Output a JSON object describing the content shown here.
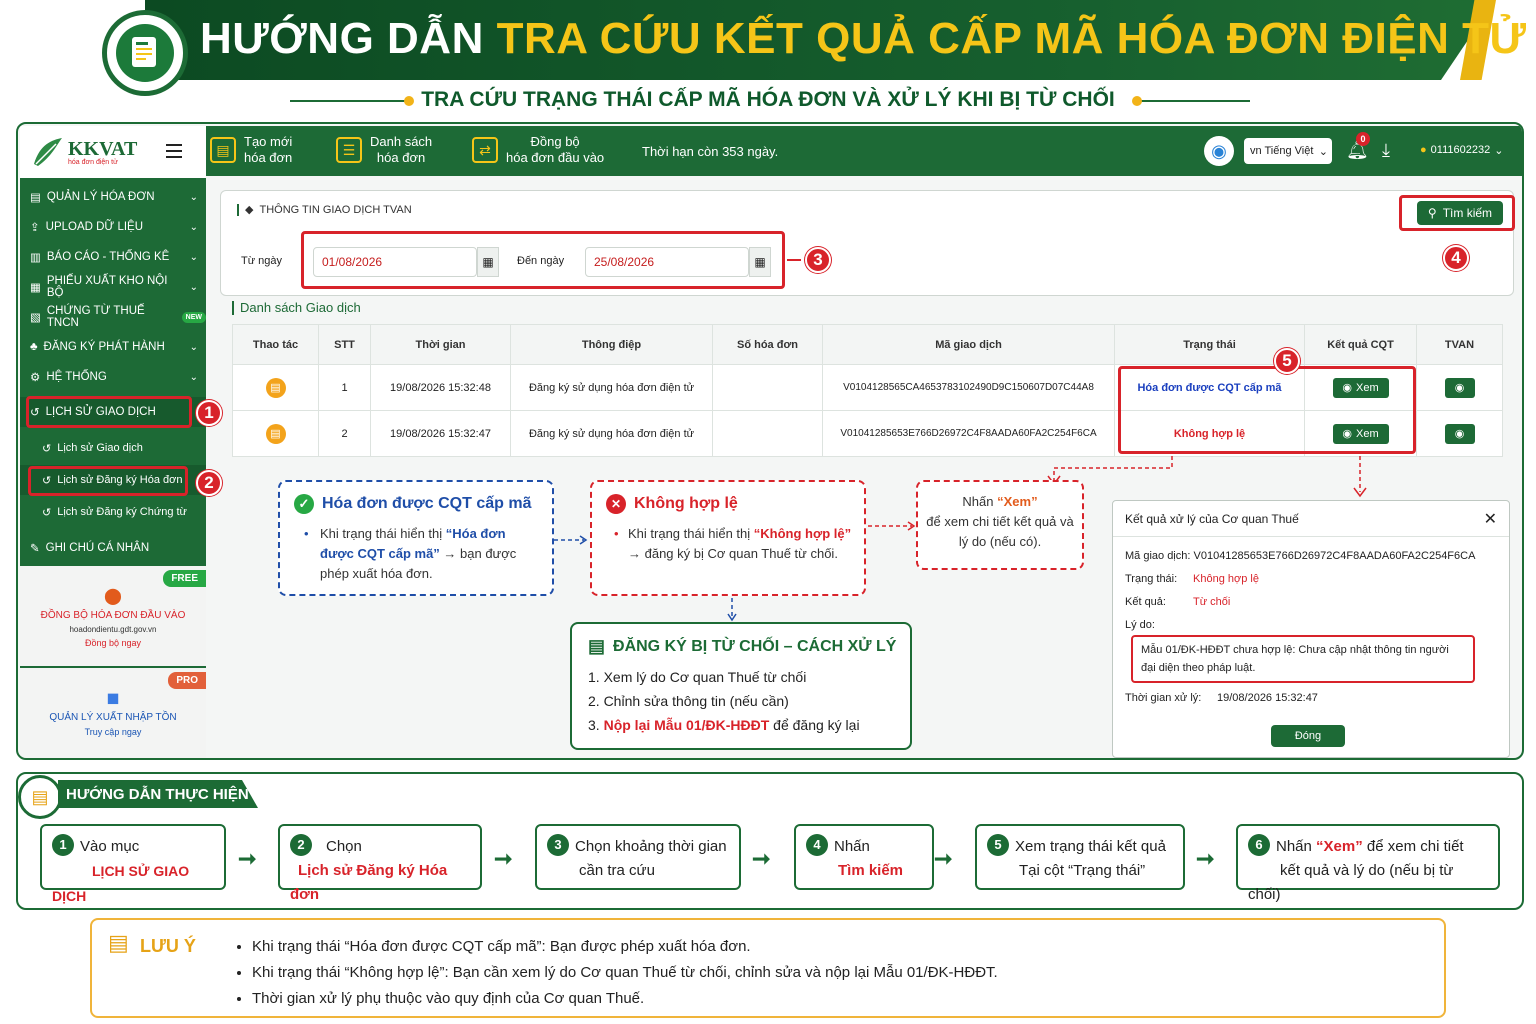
{
  "banner": {
    "title_white": "HƯỚNG DẪN",
    "title_yellow": "TRA CỨU KẾT QUẢ CẤP MÃ HÓA ĐƠN ĐIỆN TỬ",
    "subtitle": "TRA CỨU TRẠNG THÁI CẤP MÃ HÓA ĐƠN VÀ XỬ LÝ KHI BỊ TỪ CHỐI"
  },
  "sidebar": {
    "brand": "KKVAT",
    "brand_sub": "hóa đơn điện tử",
    "menu": [
      {
        "label": "QUẢN LÝ HÓA ĐƠN",
        "icon": "file-icon"
      },
      {
        "label": "UPLOAD DỮ LIỆU",
        "icon": "upload-icon"
      },
      {
        "label": "BÁO CÁO - THỐNG KÊ",
        "icon": "chart-icon"
      },
      {
        "label": "PHIẾU XUẤT KHO NỘI BỘ",
        "icon": "doc-icon"
      },
      {
        "label": "CHỨNG TỪ THUẾ TNCN",
        "icon": "doc-icon",
        "badge": "NEW"
      },
      {
        "label": "ĐĂNG KÝ PHÁT HÀNH",
        "icon": "bell-icon"
      },
      {
        "label": "HỆ THỐNG",
        "icon": "gear-icon"
      },
      {
        "label": "LỊCH SỬ GIAO DỊCH",
        "icon": "history-icon"
      }
    ],
    "submenu": [
      "Lịch sử Giao dịch",
      "Lịch sử Đăng ký Hóa đơn",
      "Lịch sử Đăng ký Chứng từ"
    ],
    "ghi_chu": "GHI CHÚ CÁ NHÂN",
    "promo1": {
      "badge": "FREE",
      "title": "ĐỒNG BỘ HÓA ĐƠN ĐẦU VÀO",
      "url": "hoadondientu.gdt.gov.vn",
      "link": "Đồng bộ ngay"
    },
    "promo2": {
      "badge": "PRO",
      "title": "QUẢN LÝ XUẤT NHẬP TỒN",
      "link": "Truy cập ngay"
    }
  },
  "topbar": {
    "btn1": [
      "Tạo mới",
      "hóa đơn"
    ],
    "btn2": [
      "Danh sách",
      "hóa đơn"
    ],
    "btn3": [
      "Đồng bộ",
      "hóa đơn đầu vào"
    ],
    "deadline": "Thời hạn còn 353 ngày.",
    "language": "vn Tiếng Việt",
    "notif_count": "0",
    "user": "0111602232"
  },
  "filter": {
    "section_title": "THÔNG TIN GIAO DỊCH TVAN",
    "from_label": "Từ ngày",
    "from_value": "01/08/2026",
    "to_label": "Đến ngày",
    "to_value": "25/08/2026",
    "search_btn": "Tìm kiếm"
  },
  "list": {
    "title": "Danh sách Giao dịch",
    "headers": [
      "Thao tác",
      "STT",
      "Thời gian",
      "Thông điệp",
      "Số hóa đơn",
      "Mã giao dịch",
      "Trạng thái",
      "Kết quả CQT",
      "TVAN"
    ],
    "rows": [
      {
        "stt": "1",
        "time": "19/08/2026 15:32:48",
        "msg": "Đăng ký sử dụng hóa đơn điện tử",
        "invoice": "",
        "code": "V0104128565CA4653783102490D9C150607D07C44A8",
        "status": "Hóa đơn được CQT cấp mã",
        "status_color": "#1a3fbf",
        "result": "Xem"
      },
      {
        "stt": "2",
        "time": "19/08/2026 15:32:47",
        "msg": "Đăng ký sử dụng hóa đơn điện tử",
        "invoice": "",
        "code": "V01041285653E766D26972C4F8AADA60FA2C254F6CA",
        "status": "Không hợp lệ",
        "status_color": "#d8232a",
        "result": "Xem"
      }
    ]
  },
  "notes": {
    "ok_title": "Hóa đơn được CQT cấp mã",
    "ok_text_1": "Khi trạng thái hiển thị ",
    "ok_text_bold": "“Hóa đơn được CQT cấp mã”",
    "ok_text_2": " → bạn được phép xuất hóa đơn.",
    "bad_title": "Không hợp lệ",
    "bad_text_1": "Khi trạng thái hiển thị ",
    "bad_text_bold": "“Không hợp lệ”",
    "bad_text_2": " → đăng ký bị Cơ quan Thuế từ chối.",
    "view_1": "Nhấn ",
    "view_bold": "“Xem”",
    "view_2": "để xem chi tiết kết quả và lý do (nếu có)."
  },
  "reject": {
    "title": "ĐĂNG KÝ BỊ TỪ CHỐI – CÁCH XỬ LÝ",
    "items": [
      "1. Xem lý do Cơ quan Thuế từ chối",
      "2. Chỉnh sửa thông tin (nếu cần)"
    ],
    "item3_num": "3. ",
    "item3_red": "Nộp lại Mẫu 01/ĐK-HĐĐT",
    "item3_rest": " để đăng ký lại"
  },
  "modal": {
    "title": "Kết quả xử lý của Cơ quan Thuế",
    "code_label": "Mã giao dịch:",
    "code": "V01041285653E766D26972C4F8AADA60FA2C254F6CA",
    "status_label": "Trạng thái:",
    "status": "Không hợp lệ",
    "result_label": "Kết quả:",
    "result": "Từ chối",
    "reason_label": "Lý do:",
    "reason": "Mẫu 01/ĐK-HĐĐT chưa hợp lệ: Chưa cập nhật thông tin người đại diện theo pháp luật.",
    "time_label": "Thời gian xử lý:",
    "time": "19/08/2026 15:32:47",
    "close_btn": "Đóng"
  },
  "guide": {
    "title": "HƯỚNG DẪN THỰC HIỆN",
    "steps": [
      {
        "num": "1",
        "l1": "Vào mục",
        "l2": "LỊCH SỬ GIAO DỊCH"
      },
      {
        "num": "2",
        "l1": "Chọn",
        "l2": "Lịch sử Đăng ký Hóa đơn"
      },
      {
        "num": "3",
        "l1": "Chọn khoảng thời gian",
        "l2": "cần tra cứu"
      },
      {
        "num": "4",
        "l1": "Nhấn",
        "l2": "Tìm kiếm"
      },
      {
        "num": "5",
        "l1": "Xem trạng thái kết quả",
        "l2": "Tại cột “Trạng thái”"
      },
      {
        "num": "6",
        "l1a": "Nhấn ",
        "l1b": "“Xem”",
        "l1c": " để xem chi tiết",
        "l2": "kết quả và lý do (nếu bị từ chối)"
      }
    ]
  },
  "luuy": {
    "title": "LƯU Ý",
    "items": [
      "Khi trạng thái “Hóa đơn được CQT cấp mã”: Bạn được phép xuất hóa đơn.",
      "Khi trạng thái “Không hợp lệ”: Bạn cần xem lý do Cơ quan Thuế từ chối, chỉnh sửa và nộp lại Mẫu 01/ĐK-HĐĐT.",
      "Thời gian xử lý phụ thuộc vào quy định của Cơ quan Thuế."
    ]
  },
  "markers": [
    "1",
    "2",
    "3",
    "4",
    "5"
  ],
  "colors": {
    "primary": "#1d6a36",
    "accent": "#f5c518",
    "danger": "#d8232a",
    "status_ok": "#1a3fbf"
  }
}
